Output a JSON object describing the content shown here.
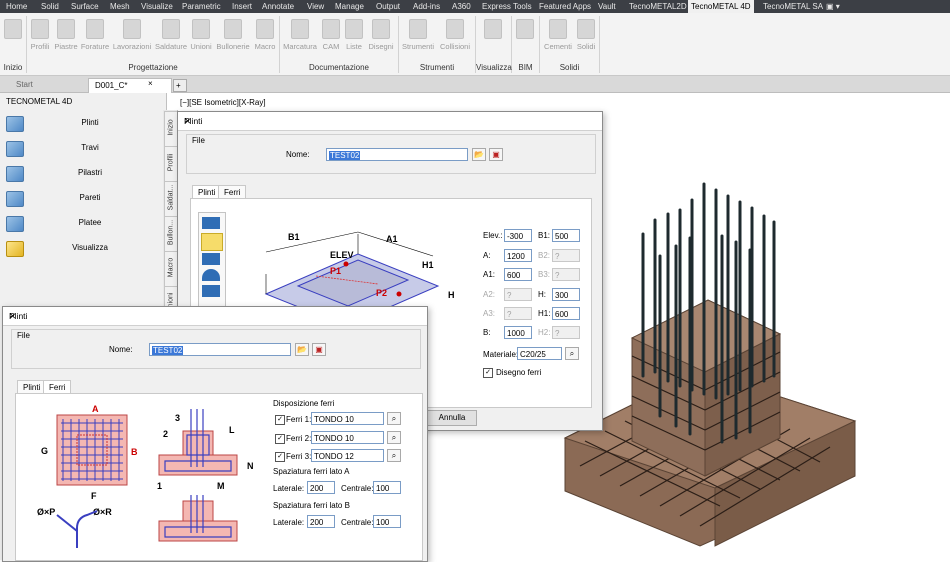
{
  "menubar": {
    "items": [
      "Home",
      "Solid",
      "Surface",
      "Mesh",
      "Visualize",
      "Parametric",
      "Insert",
      "Annotate",
      "View",
      "Manage",
      "Output",
      "Add-ins",
      "A360",
      "Express Tools",
      "Featured Apps",
      "Vault",
      "TecnoMETAL2D",
      "TecnoMETAL 4D",
      "TecnoMETAL SA"
    ],
    "overflow_icon": "▣ ▾"
  },
  "ribbon": {
    "buttons": [
      "Profili",
      "Piastre",
      "Forature",
      "Lavorazioni",
      "Saldature",
      "Unioni",
      "Bullonerie",
      "Macro",
      "Marcatura",
      "CAM",
      "Liste",
      "Disegni",
      "Strumenti",
      "Collisioni",
      "Cementi",
      "Solidi"
    ],
    "groups": [
      "Inizio",
      "Progettazione",
      "Documentazione",
      "Strumenti",
      "Visualizza",
      "BIM",
      "Solidi"
    ]
  },
  "doc_tabs": {
    "start": "Start",
    "drawing": "D001_C*",
    "add": "+"
  },
  "viewport": {
    "label": "[−][SE Isometric][X-Ray]"
  },
  "left_panel": {
    "title": "TECNOMETAL 4D",
    "items": [
      "Plinti",
      "Travi",
      "Pilastri",
      "Pareti",
      "Platee",
      "Visualizza"
    ],
    "side_tabs": [
      "Inizio",
      "Profili",
      "Saldat...",
      "Bullon...",
      "Macro",
      "Unioni"
    ]
  },
  "dialog1": {
    "title": "Plinti",
    "file_label": "File",
    "name_label": "Nome:",
    "name_value": "TEST02",
    "tabs": [
      "Plinti",
      "Ferri"
    ],
    "fields": {
      "elev_label": "Elev.:",
      "elev": "-300",
      "b1_label": "B1:",
      "b1": "500",
      "a_label": "A:",
      "a": "1200",
      "b2_label": "B2:",
      "b2": "?",
      "a1_label": "A1:",
      "a1": "600",
      "b3_label": "B3:",
      "b3": "?",
      "a2_label": "A2:",
      "a2": "?",
      "h_label": "H:",
      "h": "300",
      "a3_label": "A3:",
      "a3": "?",
      "h1_label": "H1:",
      "h1": "600",
      "b_label": "B:",
      "b": "1000",
      "h2_label": "H2:",
      "h2": "?",
      "material_label": "Materiale:",
      "material": "C20/25",
      "disegno_label": "Disegno ferri"
    },
    "diagram_labels": {
      "b1": "B1",
      "a1": "A1",
      "elev": "ELEV",
      "p1": "P1",
      "p2": "P2",
      "h1": "H1",
      "h": "H"
    },
    "annulla": "Annulla"
  },
  "dialog2": {
    "title": "Plinti",
    "file_label": "File",
    "name_label": "Nome:",
    "name_value": "TEST02",
    "tabs": [
      "Plinti",
      "Ferri"
    ],
    "disposition_label": "Disposizione ferri",
    "ferri": [
      {
        "label": "Ferri 1:",
        "value": "TONDO 10"
      },
      {
        "label": "Ferri 2:",
        "value": "TONDO 10"
      },
      {
        "label": "Ferri 3:",
        "value": "TONDO 12"
      }
    ],
    "spacing_a": {
      "title": "Spaziatura ferri lato A",
      "laterale_label": "Laterale:",
      "laterale": "200",
      "centrale_label": "Centrale:",
      "centrale": "100"
    },
    "spacing_b": {
      "title": "Spaziatura ferri lato B",
      "laterale_label": "Laterale:",
      "laterale": "200",
      "centrale_label": "Centrale:",
      "centrale": "100"
    },
    "diagram_labels": {
      "a": "A",
      "b": "B",
      "g": "G",
      "f": "F",
      "phi_p": "Ø×P",
      "phi_r": "Ø×R",
      "n3": "3",
      "n2": "2",
      "n1": "1",
      "l": "L",
      "n": "N",
      "m": "M"
    }
  },
  "colors": {
    "menubar": "#3c3f45",
    "selection": "#3b78d8",
    "concrete": "#8b6a55",
    "rebar": "#1e2a2e"
  }
}
